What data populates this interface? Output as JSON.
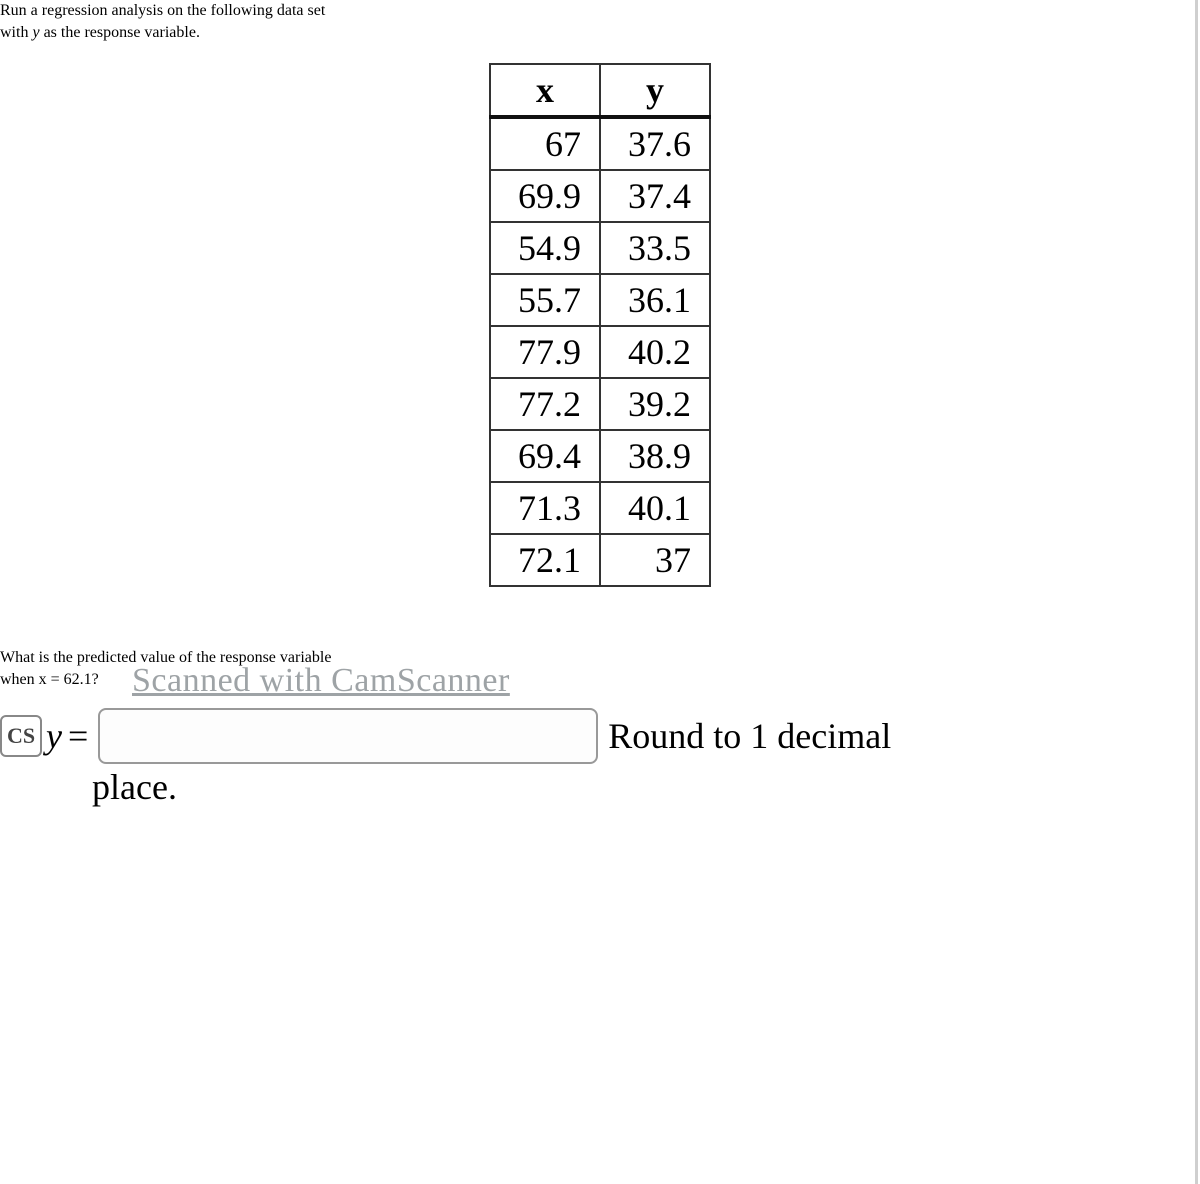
{
  "instruction": {
    "line1": "Run a regression analysis on the following data set",
    "with_prefix": "with ",
    "y_var": "y",
    "with_suffix": " as the response variable."
  },
  "table": {
    "headers": {
      "x": "x",
      "y": "y"
    },
    "rows": [
      {
        "x": "67",
        "y": "37.6"
      },
      {
        "x": "69.9",
        "y": "37.4"
      },
      {
        "x": "54.9",
        "y": "33.5"
      },
      {
        "x": "55.7",
        "y": "36.1"
      },
      {
        "x": "77.9",
        "y": "40.2"
      },
      {
        "x": "77.2",
        "y": "39.2"
      },
      {
        "x": "69.4",
        "y": "38.9"
      },
      {
        "x": "71.3",
        "y": "40.1"
      },
      {
        "x": "72.1",
        "y": "37"
      }
    ]
  },
  "question": {
    "line1": "What is the predicted value of the response variable",
    "line2": "when x = 62.1?"
  },
  "answer": {
    "cs_badge": "CS",
    "y_label": "y",
    "input_value": "",
    "round_text": "Round to 1 decimal",
    "place_text": "place."
  },
  "watermark": "Scanned with CamScanner"
}
